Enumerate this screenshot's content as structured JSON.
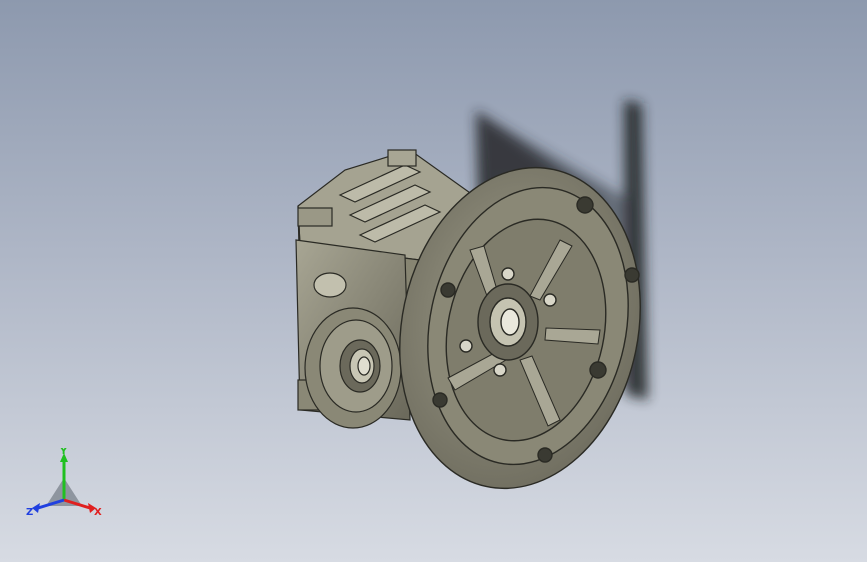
{
  "viewport": {
    "background_top": "#8d99ae",
    "background_bottom": "#d7dbe3"
  },
  "model": {
    "body_color": "#8c8a78",
    "body_dark": "#5f5d50",
    "body_light": "#b5b3a2",
    "edge_color": "#2a2a24",
    "shadow_color": "#1e2024"
  },
  "triad": {
    "x_label": "X",
    "y_label": "Y",
    "z_label": "Z",
    "x_color": "#e02020",
    "y_color": "#20c020",
    "z_color": "#2040e0"
  }
}
